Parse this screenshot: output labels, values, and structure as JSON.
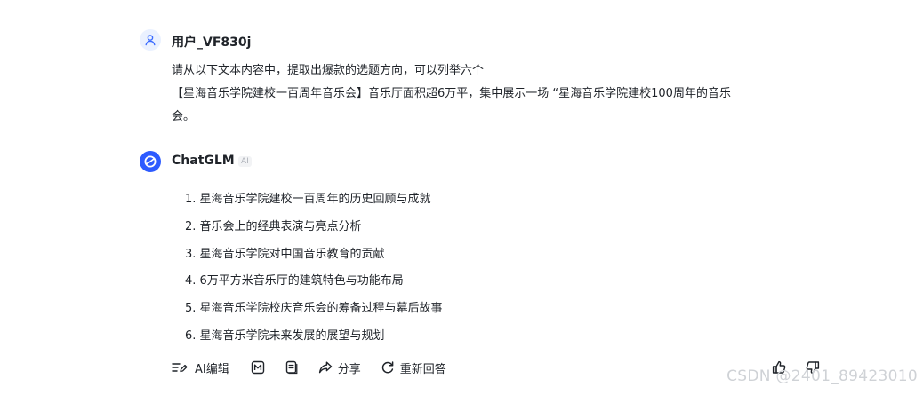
{
  "user": {
    "name": "用户_VF830j",
    "message_lines": [
      "请从以下文本内容中，提取出爆款的选题方向，可以列举六个",
      "【星海音乐学院建校一百周年音乐会】音乐厅面积超6万平，集中展示一场 “星海音乐学院建校100周年的音乐",
      "会。"
    ]
  },
  "assistant": {
    "name": "ChatGLM",
    "badge": "AI",
    "items": [
      "1. 星海音乐学院建校一百周年的历史回顾与成就",
      "2. 音乐会上的经典表演与亮点分析",
      "3. 星海音乐学院对中国音乐教育的贡献",
      "4. 6万平方米音乐厅的建筑特色与功能布局",
      "5. 星海音乐学院校庆音乐会的筹备过程与幕后故事",
      "6. 星海音乐学院未来发展的展望与规划"
    ]
  },
  "toolbar": {
    "ai_edit_label": "AI编辑",
    "share_label": "分享",
    "regenerate_label": "重新回答"
  },
  "watermark": "CSDN @2401_89423010",
  "colors": {
    "accent": "#2d5bff",
    "text": "#1f2329",
    "watermark": "#cfd2d6"
  }
}
